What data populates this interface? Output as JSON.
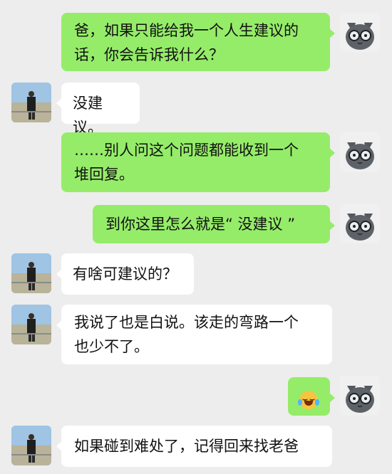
{
  "messages": [
    {
      "sender": "me",
      "text": "爸，如果只能给我一个人生建议的话，你会告诉我什么？"
    },
    {
      "sender": "dad",
      "text": "没建议。"
    },
    {
      "sender": "me",
      "text": "……别人问这个问题都能收到一个堆回复。"
    },
    {
      "sender": "me",
      "text": "到你这里怎么就是“ 没建议 ”"
    },
    {
      "sender": "dad",
      "text": "有啥可建议的？"
    },
    {
      "sender": "dad",
      "text": "我说了也是白说。该走的弯路一个也少不了。"
    },
    {
      "sender": "me",
      "emoji": "laughing-crying-emoji"
    },
    {
      "sender": "dad",
      "text": "如果碰到难处了，记得回来找老爸"
    }
  ],
  "lines": {
    "m1_l1": "爸，如果只能给我一个人生建议的",
    "m1_l2": "话，你会告诉我什么？",
    "m3_l1": "……别人问这个问题都能收到一个",
    "m3_l2": "堆回复。",
    "m6_l1": "我说了也是白说。该走的弯路一个",
    "m6_l2": "也少不了。"
  },
  "avatars": {
    "me": "cat-with-glasses-avatar",
    "dad": "father-outdoor-photo-avatar"
  },
  "colors": {
    "background": "#ededed",
    "my_bubble": "#95ec69",
    "dad_bubble": "#ffffff"
  }
}
